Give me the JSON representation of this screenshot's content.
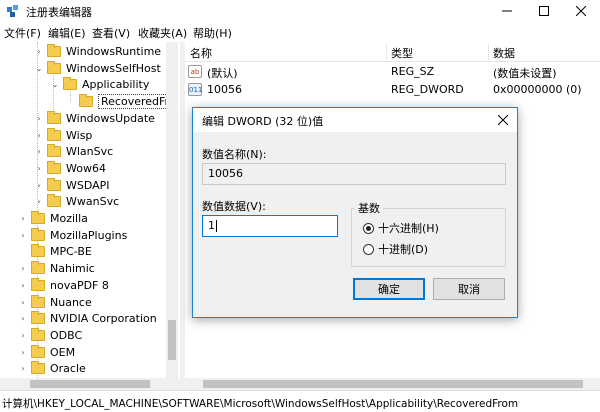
{
  "window": {
    "title": "注册表编辑器",
    "min_icon": "minimize-icon",
    "max_icon": "maximize-icon",
    "close_icon": "close-icon"
  },
  "menu": [
    "文件(F)",
    "编辑(E)",
    "查看(V)",
    "收藏夹(A)",
    "帮助(H)"
  ],
  "tree": [
    {
      "label": "WindowsRuntime",
      "expander": "›"
    },
    {
      "label": "WindowsSelfHost",
      "expander": "⌄"
    },
    {
      "label": "Applicability",
      "expander": "⌄"
    },
    {
      "label": "RecoveredFr",
      "expander": "",
      "selected": true
    },
    {
      "label": "WindowsUpdate",
      "expander": "›"
    },
    {
      "label": "Wisp",
      "expander": "›"
    },
    {
      "label": "WlanSvc",
      "expander": "›"
    },
    {
      "label": "Wow64",
      "expander": "›"
    },
    {
      "label": "WSDAPI",
      "expander": "›"
    },
    {
      "label": "WwanSvc",
      "expander": "›"
    },
    {
      "label": "Mozilla",
      "expander": "›"
    },
    {
      "label": "MozillaPlugins",
      "expander": "›"
    },
    {
      "label": "MPC-BE",
      "expander": ""
    },
    {
      "label": "Nahimic",
      "expander": "›"
    },
    {
      "label": "novaPDF 8",
      "expander": "›"
    },
    {
      "label": "Nuance",
      "expander": "›"
    },
    {
      "label": "NVIDIA Corporation",
      "expander": "›"
    },
    {
      "label": "ODBC",
      "expander": "›"
    },
    {
      "label": "OEM",
      "expander": "›"
    },
    {
      "label": "Oracle",
      "expander": "›"
    }
  ],
  "list": {
    "headers": {
      "name": "名称",
      "type": "类型",
      "data": "数据"
    },
    "rows": [
      {
        "icon": "ab",
        "name": "(默认)",
        "type": "REG_SZ",
        "data": "(数值未设置)"
      },
      {
        "icon": "011",
        "name": "10056",
        "type": "REG_DWORD",
        "data": "0x00000000 (0)"
      }
    ]
  },
  "dialog": {
    "title": "编辑 DWORD (32 位)值",
    "value_name_label": "数值名称(N):",
    "value_name": "10056",
    "value_data_label": "数值数据(V):",
    "value_data": "1",
    "base_label": "基数",
    "hex_label": "十六进制(H)",
    "dec_label": "十进制(D)",
    "selected_base": "hex",
    "ok_label": "确定",
    "cancel_label": "取消"
  },
  "status": {
    "path": "计算机\\HKEY_LOCAL_MACHINE\\SOFTWARE\\Microsoft\\WindowsSelfHost\\Applicability\\RecoveredFrom"
  },
  "colors": {
    "folder": "#f5cd4e",
    "accent": "#0078d7"
  }
}
